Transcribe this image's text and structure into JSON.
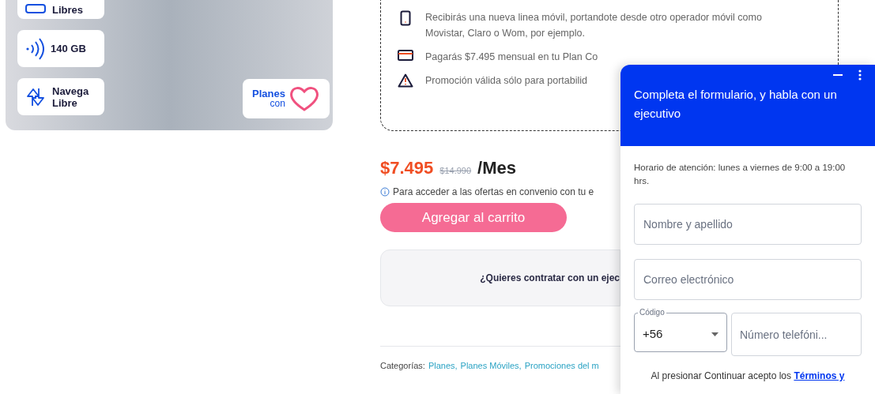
{
  "product_image": {
    "features": [
      {
        "kind": "devices",
        "label": "Libres"
      },
      {
        "kind": "signal",
        "label": "140 GB"
      },
      {
        "kind": "arrows",
        "label": "Navega Libre"
      }
    ],
    "badge": {
      "line1": "Planes",
      "line2": "con"
    }
  },
  "conditions": [
    {
      "kind": "phone",
      "text": "Recibirás una nueva linea móvil, portandote desde otro operador móvil como Movistar, Claro o Wom, por ejemplo."
    },
    {
      "kind": "card",
      "text": "Pagarás $7.495 mensual en tu Plan Co"
    },
    {
      "kind": "warning",
      "text": "Promoción válida sólo para portabilid"
    }
  ],
  "price": {
    "current": "$7.495",
    "original": "$14.990",
    "period": "/Mes"
  },
  "info_note": "Para acceder a las ofertas en convenio con tu e",
  "add_to_cart": "Agregar al carrito",
  "executive_prompt": "¿Quieres contratar con un ejec",
  "categories": {
    "label": "Categorías:",
    "links": [
      "Planes,",
      "Planes Móviles,",
      "Promociones del m"
    ]
  },
  "chat_widget": {
    "title": "Completa el formulario, y habla con un ejecutivo",
    "hours": "Horario de atención: lunes a viernes de 9:00 a 19:00 hrs.",
    "name_field": {
      "placeholder": "Nombre y apellido"
    },
    "email_field": {
      "placeholder": "Correo electrónico"
    },
    "code_field": {
      "label": "Código",
      "value": "+56"
    },
    "phone_field": {
      "placeholder": "Número telefóni..."
    },
    "terms": {
      "text": "Al presionar Continuar acepto los",
      "link": "Términos y"
    }
  }
}
